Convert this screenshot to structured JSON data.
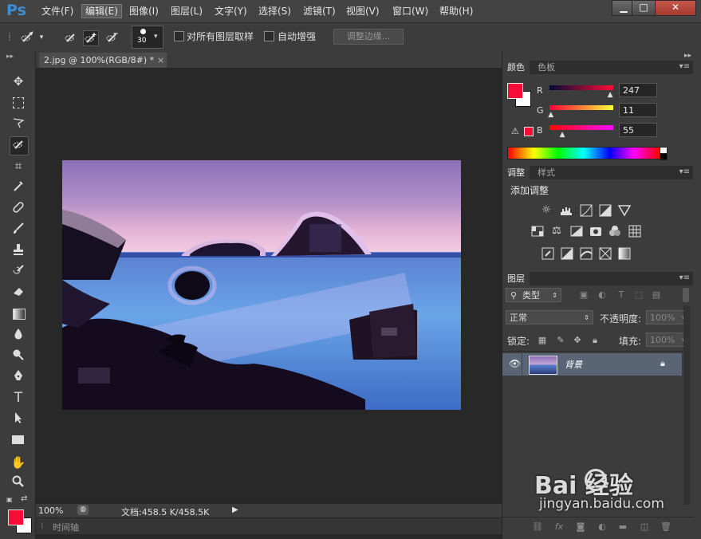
{
  "app": {
    "logo": "Ps"
  },
  "menu": [
    "文件(F)",
    "编辑(E)",
    "图像(I)",
    "图层(L)",
    "文字(Y)",
    "选择(S)",
    "滤镜(T)",
    "视图(V)",
    "窗口(W)",
    "帮助(H)"
  ],
  "menu_active": "编辑(E)",
  "window_controls": {
    "minimize": "▁",
    "maximize": "□",
    "close": "✕"
  },
  "options": {
    "brush_size": "30",
    "sample_all_layers_label": "对所有图层取样",
    "auto_enhance_label": "自动增强",
    "refine_edge_label": "调整边缘..."
  },
  "document": {
    "tab_title": "2.jpg @ 100%(RGB/8#) *",
    "tab_close": "×",
    "zoom": "100%",
    "doc_info": "文档:458.5 K/458.5K",
    "timeline_label": "时间轴"
  },
  "color_panel": {
    "tabs": [
      "颜色",
      "色板"
    ],
    "channels": [
      {
        "label": "R",
        "value": "247",
        "fraction": 0.97
      },
      {
        "label": "G",
        "value": "11",
        "fraction": 0.04
      },
      {
        "label": "B",
        "value": "55",
        "fraction": 0.22
      }
    ],
    "foreground": "#f70b37",
    "background": "#ffffff"
  },
  "adjustments_panel": {
    "tabs": [
      "调整",
      "样式"
    ],
    "add_label": "添加调整"
  },
  "layers_panel": {
    "tab": "图层",
    "filter_label": "类型",
    "blend_mode": "正常",
    "opacity_label": "不透明度:",
    "opacity_value": "100%",
    "lock_label": "锁定:",
    "fill_label": "填充:",
    "fill_value": "100%",
    "layers": [
      {
        "name": "背景",
        "locked": true,
        "visible": true
      }
    ]
  },
  "watermark": {
    "brand": "Bai  经验",
    "url": "jingyan.baidu.com"
  }
}
